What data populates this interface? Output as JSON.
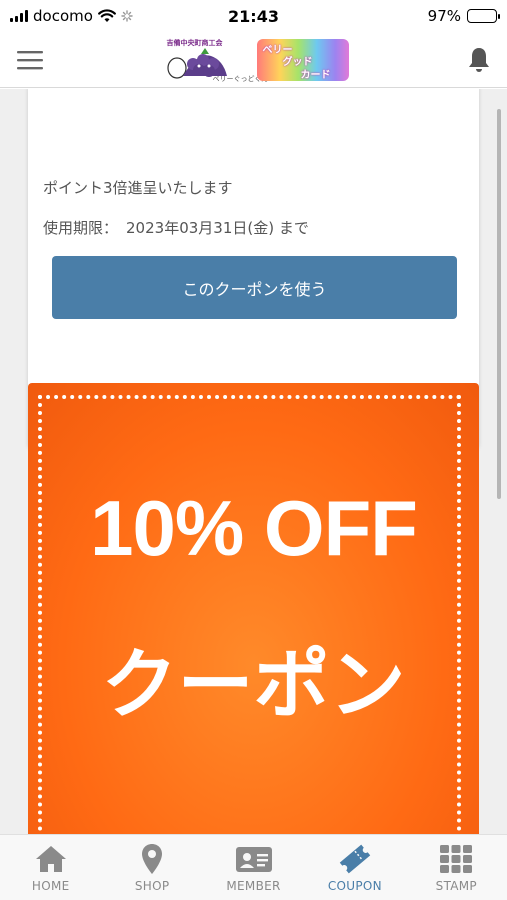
{
  "status_bar": {
    "carrier": "docomo",
    "time": "21:43",
    "battery_percent": "97%",
    "battery_level": 0.97
  },
  "header": {
    "logo_assoc": "吉備中央町商工会",
    "logo_sub": "ベリーぐっどくん",
    "logo_card_line1": "ベリー",
    "logo_card_line2": "グッド",
    "logo_card_line3": "カード",
    "menu_icon": "hamburger-menu-icon",
    "notification_icon": "bell-icon"
  },
  "coupon": {
    "description": "ポイント3倍進呈いたします",
    "expiry_label": "使用期限：",
    "expiry_value": "2023年03月31日(金) まで",
    "use_button_label": "このクーポンを使う"
  },
  "coupon_image": {
    "line1": "10% OFF",
    "line2": "クーポン",
    "color": "#ff6a14"
  },
  "tab_bar": {
    "items": [
      {
        "label": "HOME",
        "icon": "home-icon"
      },
      {
        "label": "SHOP",
        "icon": "map-pin-icon"
      },
      {
        "label": "MEMBER",
        "icon": "member-card-icon"
      },
      {
        "label": "COUPON",
        "icon": "ticket-icon"
      },
      {
        "label": "STAMP",
        "icon": "grid-icon"
      }
    ],
    "active": "COUPON",
    "active_color": "#4a7ea8",
    "inactive_color": "#8a8a8a"
  }
}
